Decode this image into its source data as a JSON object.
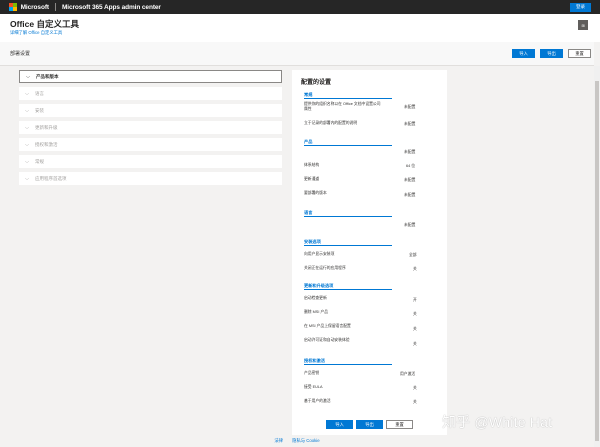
{
  "topbar": {
    "brand": "Microsoft",
    "app_title": "Microsoft 365 Apps admin center",
    "signin_label": "登录",
    "logo_colors": [
      "#f25022",
      "#7fba00",
      "#00a4ef",
      "#ffb900"
    ]
  },
  "header": {
    "title": "Office 自定义工具",
    "learn_link": "详细了解 Office 自定义工具",
    "avatar_glyph": "⊞"
  },
  "toolbar": {
    "title": "部署设置",
    "import_label": "导入",
    "export_label": "导出",
    "reset_label": "重置"
  },
  "steps": [
    {
      "label": "产品和版本",
      "active": true
    },
    {
      "label": "语言",
      "active": false
    },
    {
      "label": "安装",
      "active": false
    },
    {
      "label": "更新和升级",
      "active": false
    },
    {
      "label": "授权和激活",
      "active": false
    },
    {
      "label": "常规",
      "active": false
    },
    {
      "label": "应用程序首选项",
      "active": false
    }
  ],
  "summary": {
    "title": "配置的设置",
    "sections": {
      "general": "常规",
      "products": "产品",
      "languages": "语言",
      "installation": "安装选项",
      "updates": "更新和升级选项",
      "licensing": "授权和激活"
    },
    "rows": {
      "g1_label": "提供你的组织名称以在 Office 文档中设置公司属性",
      "g1_value": "未配置",
      "g2_label": "立于记录的部署内的配置的说明",
      "g2_value": "未配置",
      "p0_value": "未配置",
      "p1_label": "体系结构",
      "p1_value": "64 位",
      "p2_label": "更新通道",
      "p2_value": "未配置",
      "p3_label": "要部署的版本",
      "p3_value": "未配置",
      "l1_value": "未配置",
      "i1_label": "向用户显示安装项",
      "i1_value": "全部",
      "i2_label": "关闭正在运行的应用程序",
      "i2_value": "关",
      "u1_label": "启动检查更新",
      "u1_value": "开",
      "u2_label": "删除 MSI 产品",
      "u2_value": "关",
      "u3_label": "在 MSI 产品上保留语言配置",
      "u3_value": "关",
      "u4_label": "启动许可证和自动安装体验",
      "u4_value": "关",
      "a1_label": "产品密钥",
      "a1_value": "用户激活",
      "a2_label": "接受 EULA",
      "a2_value": "关",
      "a3_label": "基于用户的激活",
      "a3_value": "关"
    },
    "import_label": "导入",
    "export_label": "导出",
    "reset_label": "重置"
  },
  "footer": {
    "legal": "法律",
    "privacy": "隐私与 Cookie"
  },
  "watermark": "知乎 @White Hat",
  "colors": {
    "accent": "#0078d4",
    "topbar": "#262626"
  }
}
